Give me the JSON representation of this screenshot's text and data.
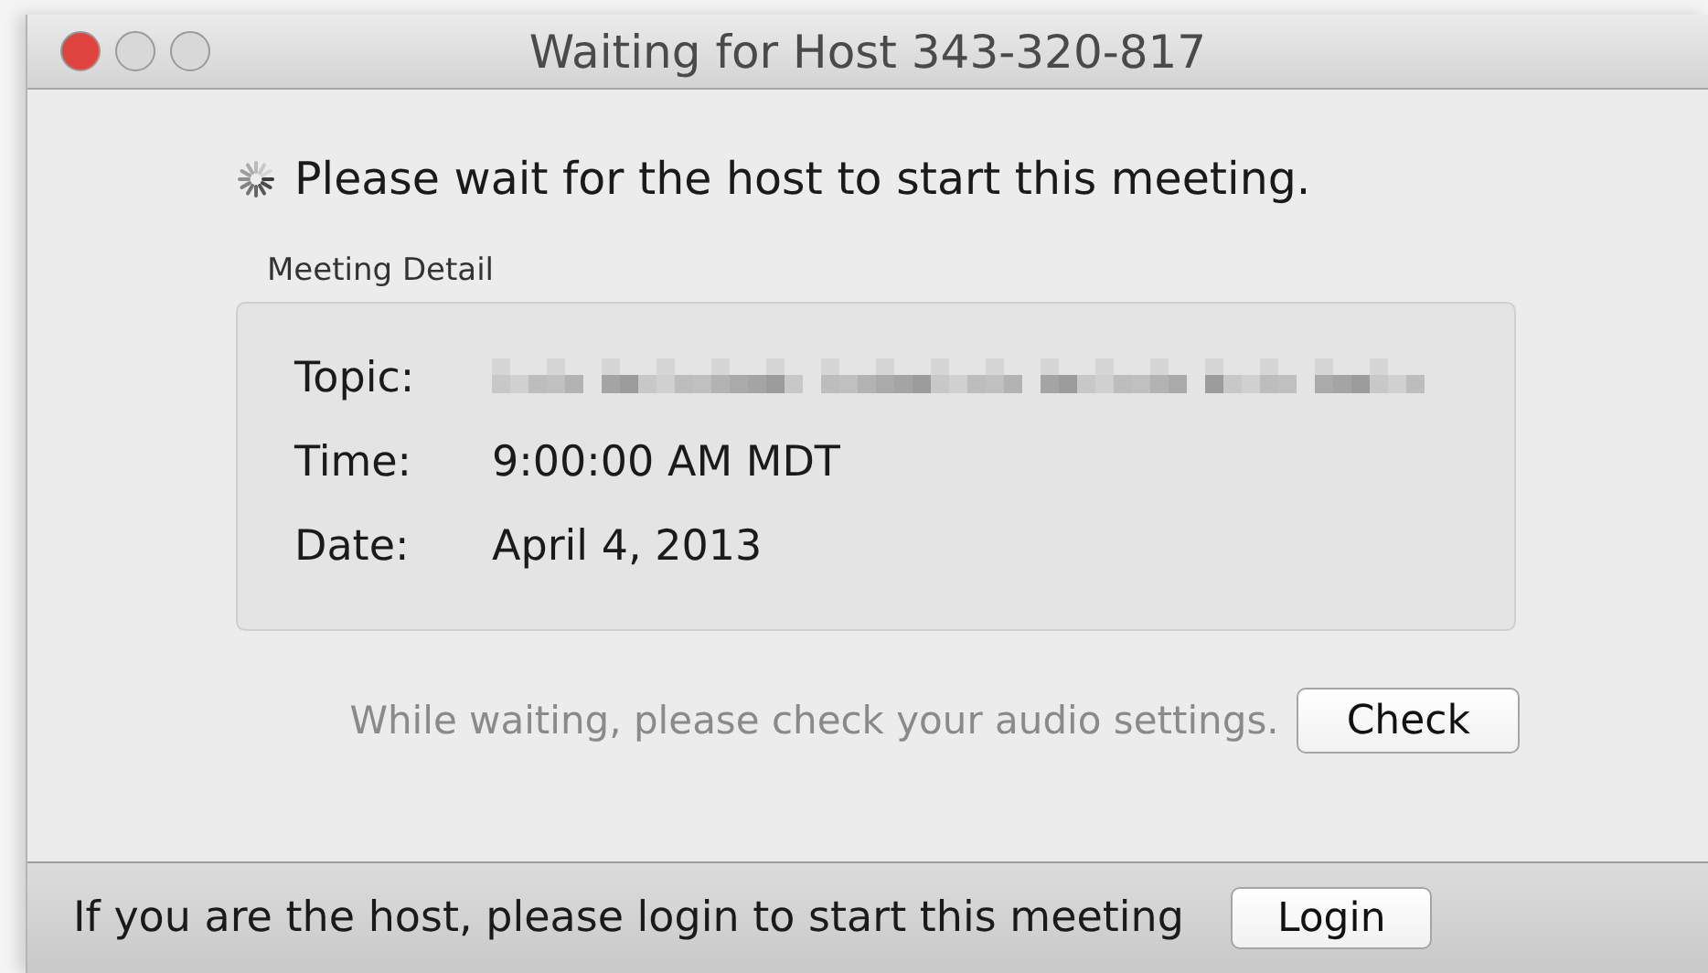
{
  "window": {
    "title": "Waiting for Host 343-320-817",
    "buttons": [
      {
        "color": "#e0443e"
      },
      {
        "color": "#d8d8d8"
      },
      {
        "color": "#d8d8d8"
      }
    ]
  },
  "status": {
    "message": "Please wait for the host to start this meeting."
  },
  "meeting_detail": {
    "title": "Meeting Detail",
    "rows": [
      {
        "label": "Topic:",
        "kind": "redacted"
      },
      {
        "label": "Time:",
        "kind": "text",
        "value": "9:00:00 AM MDT"
      },
      {
        "label": "Date:",
        "kind": "text",
        "value": "April 4, 2013"
      }
    ]
  },
  "audio": {
    "hint": "While waiting, please check your audio settings.",
    "button": "Check"
  },
  "footer": {
    "message": "If you are the host, please login to start this meeting",
    "button": "Login"
  }
}
